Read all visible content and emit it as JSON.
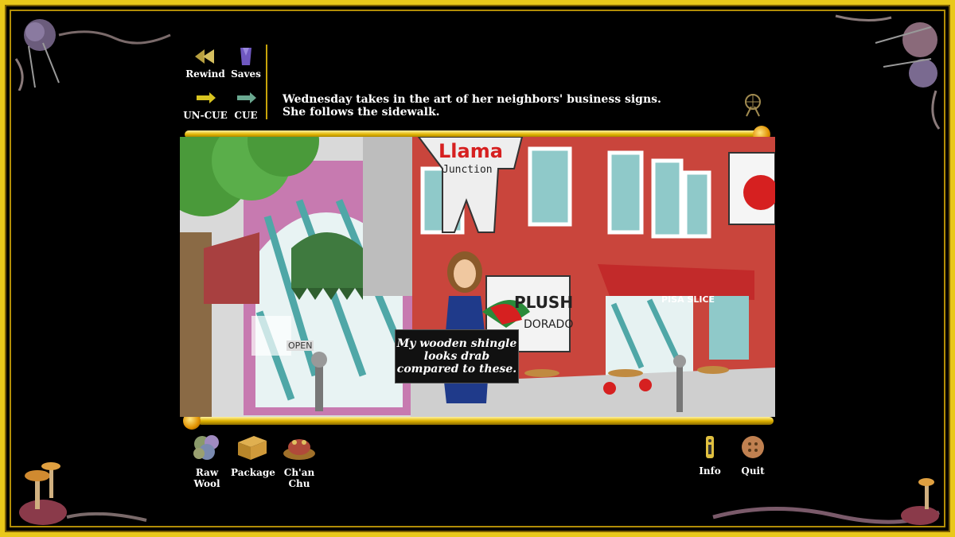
{
  "toolbar": {
    "rewind_label": "Rewind",
    "saves_label": "Saves",
    "uncue_label": "UN-CUE",
    "cue_label": "CUE"
  },
  "narration": {
    "line1": "Wednesday takes in the art of her neighbors' business signs.",
    "line2": "She follows the sidewalk."
  },
  "scene": {
    "sign_llama": "Llama",
    "sign_junction": "Junction",
    "sign_pisa": "PISA SLICE",
    "sign_plush": "PLUSH",
    "sign_dorado": "DORADO",
    "sign_open": "OPEN"
  },
  "speech": {
    "line1": "My wooden shingle",
    "line2": "looks drab",
    "line3": "compared to these."
  },
  "inventory": {
    "raw_wool": "Raw Wool",
    "package": "Package",
    "chan_chu": "Ch'an Chu"
  },
  "menu": {
    "info_label": "Info",
    "quit_label": "Quit"
  },
  "colors": {
    "frame_gold": "#e9c81a",
    "background": "#000000",
    "brick": "#c9453c",
    "awning_red": "#c22a2a"
  }
}
